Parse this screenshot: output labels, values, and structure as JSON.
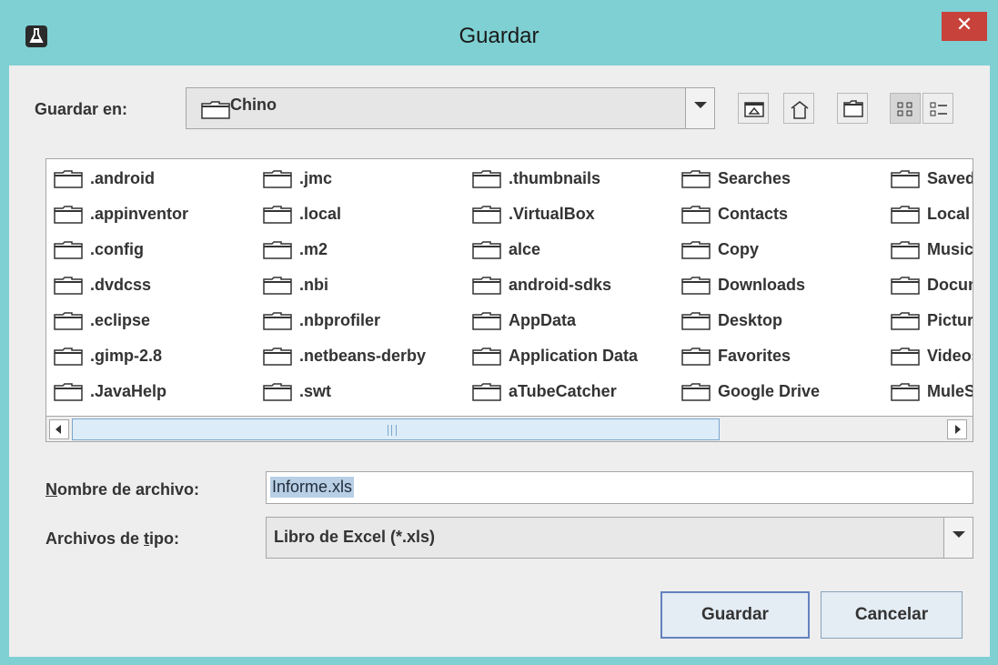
{
  "window": {
    "title": "Guardar",
    "close_glyph": "✕",
    "app_icon": "flask-icon"
  },
  "toolbar": {
    "save_in_label": "Guardar en:",
    "current_folder": "Chino",
    "buttons": [
      "up-one-level-icon",
      "home-icon",
      "new-folder-icon",
      "list-view-icon",
      "details-view-icon"
    ]
  },
  "files": [
    [
      ".android",
      ".appinventor",
      ".config",
      ".dvdcss",
      ".eclipse",
      ".gimp-2.8",
      ".JavaHelp"
    ],
    [
      ".jmc",
      ".local",
      ".m2",
      ".nbi",
      ".nbprofiler",
      ".netbeans-derby",
      ".swt"
    ],
    [
      ".thumbnails",
      ".VirtualBox",
      "alce",
      "android-sdks",
      "AppData",
      "Application Data",
      "aTubeCatcher"
    ],
    [
      "Searches",
      "Contacts",
      "Copy",
      "Downloads",
      "Desktop",
      "Favorites",
      "Google Drive"
    ],
    [
      "Saved",
      "Local",
      "Music",
      "Documents",
      "Pictures",
      "Videos",
      "MuleS"
    ]
  ],
  "file_name": {
    "label_first": "N",
    "label_rest": "ombre de archivo:",
    "value": "Informe.xls"
  },
  "file_type": {
    "label_pre": "Archivos de ",
    "label_ul": "t",
    "label_post": "ipo:",
    "value": "Libro de Excel (*.xls)"
  },
  "buttons": {
    "save": "Guardar",
    "cancel": "Cancelar"
  },
  "colors": {
    "title_bar": "#7fd0d3",
    "close_button": "#c7423b",
    "selection": "#b8cfe5",
    "default_button_border": "#6382bf"
  }
}
